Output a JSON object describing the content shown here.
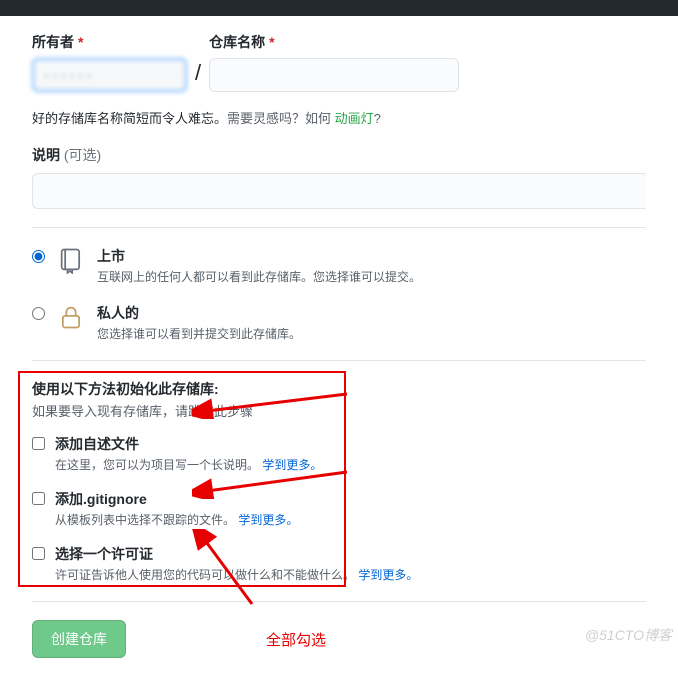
{
  "labels": {
    "owner": "所有者",
    "repo": "仓库名称",
    "required": "*"
  },
  "ownerValue": "· · · · ·  ·",
  "slash": "/",
  "hint": {
    "prefix": "好的存储库名称简短而令人难忘。",
    "inspire": "需要灵感吗？如何 ",
    "link": "动画灯",
    "q": "?"
  },
  "description": {
    "label": "说明",
    "optional": "(可选)"
  },
  "visibility": {
    "public": {
      "title": "上市",
      "sub": "互联网上的任何人都可以看到此存储库。您选择谁可以提交。"
    },
    "private": {
      "title": "私人的",
      "sub": "您选择谁可以看到并提交到此存储库。"
    }
  },
  "init": {
    "title": "使用以下方法初始化此存储库:",
    "hint": "如果要导入现有存储库，请跳过此步骤",
    "readme": {
      "title": "添加自述文件",
      "sub": "在这里，您可以为项目写一个长说明。",
      "more": "学到更多。"
    },
    "gitignore": {
      "title": "添加.gitignore",
      "sub": "从模板列表中选择不跟踪的文件。",
      "more": "学到更多。"
    },
    "license": {
      "title": "选择一个许可证",
      "sub": "许可证告诉他人使用您的代码可以做什么和不能做什么。",
      "more": "学到更多。"
    }
  },
  "button": "创建仓库",
  "annotation": "全部勾选",
  "watermark": "@51CTO博客"
}
